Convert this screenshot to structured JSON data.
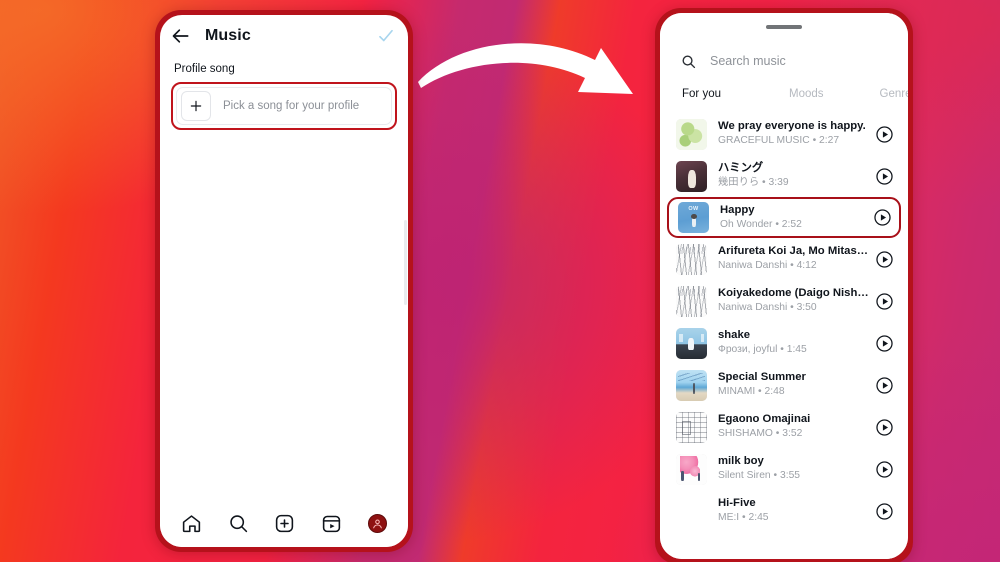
{
  "background": {
    "colors": [
      "#f05a28",
      "#f4243c",
      "#c52a72",
      "#c12a72"
    ]
  },
  "arrow": {
    "icon": "curved-arrow-right-icon"
  },
  "left_phone": {
    "header": {
      "back_icon": "back-arrow-icon",
      "title": "Music",
      "confirm_icon": "checkmark-icon",
      "confirm_color": "#a8d5ee"
    },
    "section_label": "Profile song",
    "pick_song": {
      "plus_icon": "plus-icon",
      "text": "Pick a song for your profile",
      "highlight_color": "#c0141c"
    },
    "navbar": {
      "items": [
        {
          "icon": "home-icon",
          "label": "Home"
        },
        {
          "icon": "search-icon",
          "label": "Search"
        },
        {
          "icon": "add-post-icon",
          "label": "Create"
        },
        {
          "icon": "reels-icon",
          "label": "Reels"
        },
        {
          "icon": "profile-avatar-icon",
          "label": "Profile"
        }
      ]
    }
  },
  "right_phone": {
    "drag_handle": "drag-handle",
    "search": {
      "icon": "search-icon",
      "placeholder": "Search music",
      "value": ""
    },
    "tabs": [
      {
        "label": "For you",
        "active": true
      },
      {
        "label": "Moods",
        "active": false
      },
      {
        "label": "Genres",
        "active": false
      }
    ],
    "songs": [
      {
        "title": "We pray everyone is happy.",
        "artist": "GRACEFUL MUSIC",
        "duration": "2:27",
        "subtitle": "GRACEFUL MUSIC • 2:27",
        "art": "green-leaves",
        "highlighted": false,
        "play_icon": "play-circle-icon"
      },
      {
        "title": "ハミング",
        "artist": "幾田りら",
        "duration": "3:39",
        "subtitle": "幾田りら • 3:39",
        "art": "dark-photo",
        "highlighted": false,
        "play_icon": "play-circle-icon"
      },
      {
        "title": "Happy",
        "artist": "Oh Wonder",
        "duration": "2:52",
        "subtitle": "Oh Wonder • 2:52",
        "art": "blue-ow",
        "highlighted": true,
        "play_icon": "play-circle-icon"
      },
      {
        "title": "Arifureta Koi Ja, Mo Mitasarenai",
        "artist": "Naniwa Danshi",
        "duration": "4:12",
        "subtitle": "Naniwa Danshi • 4:12",
        "art": "sketch-group",
        "highlighted": false,
        "play_icon": "play-circle-icon"
      },
      {
        "title": "Koiyakedome (Daigo Nishihata/Ry...",
        "artist": "Naniwa Danshi",
        "duration": "3:50",
        "subtitle": "Naniwa Danshi • 3:50",
        "art": "sketch-group",
        "highlighted": false,
        "play_icon": "play-circle-icon"
      },
      {
        "title": "shake",
        "artist": "Фрози, joyful",
        "duration": "1:45",
        "subtitle": "Фрози, joyful • 1:45",
        "art": "blue-stage",
        "highlighted": false,
        "play_icon": "play-circle-icon"
      },
      {
        "title": "Special Summer",
        "artist": "MINAMI",
        "duration": "2:48",
        "subtitle": "MINAMI • 2:48",
        "art": "beach",
        "highlighted": false,
        "play_icon": "play-circle-icon"
      },
      {
        "title": "Egaono Omajinai",
        "artist": "SHISHAMO",
        "duration": "3:52",
        "subtitle": "SHISHAMO • 3:52",
        "art": "sketch-room",
        "highlighted": false,
        "play_icon": "play-circle-icon"
      },
      {
        "title": "milk boy",
        "artist": "Silent Siren",
        "duration": "3:55",
        "subtitle": "Silent Siren • 3:55",
        "art": "pink-flower",
        "highlighted": false,
        "play_icon": "play-circle-icon"
      },
      {
        "title": "Hi-Five",
        "artist": "ME:I",
        "duration": "2:45",
        "subtitle": "ME:I • 2:45",
        "art": "none",
        "highlighted": false,
        "play_icon": "play-circle-icon"
      }
    ]
  }
}
